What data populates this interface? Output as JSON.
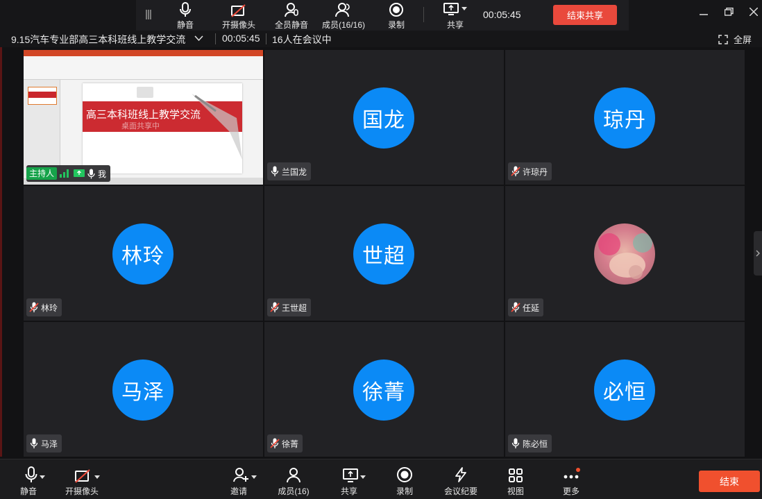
{
  "top_toolbar": {
    "mute_label": "静音",
    "camera_label": "开摄像头",
    "mute_all_label": "全员静音",
    "members_label": "成员(16/16)",
    "record_label": "录制",
    "share_label": "共享",
    "timer": "00:05:45",
    "end_share_label": "结束共享"
  },
  "info_bar": {
    "meeting_title": "9.15汽车专业部高三本科班线上教学交流",
    "elapsed": "00:05:45",
    "attendance": "16人在会议中",
    "fullscreen_label": "全屏"
  },
  "shared_screen": {
    "slide_title": "高三本科班线上教学交流",
    "sharing_overlay": "桌面共享中",
    "host_badge": "主持人",
    "self_name": "我"
  },
  "participants": [
    {
      "avatar": "国龙",
      "name": "兰国龙",
      "muted": false
    },
    {
      "avatar": "琼丹",
      "name": "许琼丹",
      "muted": true
    },
    {
      "avatar": "林玲",
      "name": "林玲",
      "muted": true
    },
    {
      "avatar": "世超",
      "name": "王世超",
      "muted": true
    },
    {
      "avatar": "",
      "name": "任延",
      "muted": true,
      "photo": true
    },
    {
      "avatar": "马泽",
      "name": "马泽",
      "muted": false
    },
    {
      "avatar": "徐菁",
      "name": "徐菁",
      "muted": true
    },
    {
      "avatar": "必恒",
      "name": "陈必恒",
      "muted": false
    }
  ],
  "bottom_toolbar": {
    "mute_label": "静音",
    "camera_label": "开摄像头",
    "invite_label": "邀请",
    "members_label": "成员(16)",
    "share_label": "共享",
    "record_label": "录制",
    "minutes_label": "会议纪要",
    "view_label": "视图",
    "more_label": "更多",
    "end_label": "结束"
  },
  "colors": {
    "avatar_blue": "#0b8af6",
    "end_red": "#f0502e",
    "host_green": "#16a34a",
    "tile_bg": "#222225"
  }
}
